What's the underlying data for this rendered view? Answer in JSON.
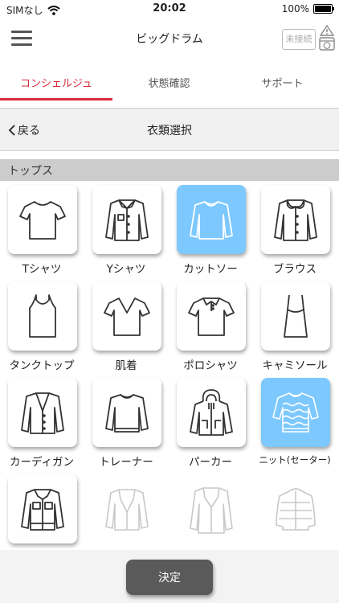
{
  "status_bar": {
    "carrier": "SIMなし",
    "time": "20:02",
    "battery": "100%",
    "battery_level": 1.0
  },
  "nav": {
    "title": "ビッグドラム",
    "connection_status": "未接続"
  },
  "tabs": [
    {
      "label": "コンシェルジュ",
      "active": true
    },
    {
      "label": "状態確認",
      "active": false
    },
    {
      "label": "サポート",
      "active": false
    }
  ],
  "subheader": {
    "back_label": "戻る",
    "title": "衣類選択"
  },
  "section": {
    "label": "トップス"
  },
  "items": [
    {
      "label": "Tシャツ",
      "icon": "tshirt-icon",
      "selected": false,
      "enabled": true
    },
    {
      "label": "Yシャツ",
      "icon": "dress-shirt-icon",
      "selected": false,
      "enabled": true
    },
    {
      "label": "カットソー",
      "icon": "cutsew-icon",
      "selected": true,
      "enabled": true
    },
    {
      "label": "ブラウス",
      "icon": "blouse-icon",
      "selected": false,
      "enabled": true
    },
    {
      "label": "タンクトップ",
      "icon": "tank-top-icon",
      "selected": false,
      "enabled": true
    },
    {
      "label": "肌着",
      "icon": "undershirt-icon",
      "selected": false,
      "enabled": true
    },
    {
      "label": "ポロシャツ",
      "icon": "polo-shirt-icon",
      "selected": false,
      "enabled": true
    },
    {
      "label": "キャミソール",
      "icon": "camisole-icon",
      "selected": false,
      "enabled": true
    },
    {
      "label": "カーディガン",
      "icon": "cardigan-icon",
      "selected": false,
      "enabled": true
    },
    {
      "label": "トレーナー",
      "icon": "sweatshirt-icon",
      "selected": false,
      "enabled": true
    },
    {
      "label": "パーカー",
      "icon": "hoodie-icon",
      "selected": false,
      "enabled": true
    },
    {
      "label": "ニット(セーター)",
      "icon": "knit-sweater-icon",
      "selected": true,
      "enabled": true
    },
    {
      "label": "",
      "icon": "denim-jacket-icon",
      "selected": false,
      "enabled": true
    },
    {
      "label": "",
      "icon": "blazer-icon",
      "selected": false,
      "enabled": false
    },
    {
      "label": "",
      "icon": "coat-icon",
      "selected": false,
      "enabled": false
    },
    {
      "label": "",
      "icon": "down-jacket-icon",
      "selected": false,
      "enabled": false
    }
  ],
  "footer": {
    "decide_label": "決定"
  },
  "colors": {
    "accent": "#d92b3a",
    "selected_tile": "#7cc8ff",
    "section_band": "#cccccc",
    "button": "#5a5a5a"
  }
}
